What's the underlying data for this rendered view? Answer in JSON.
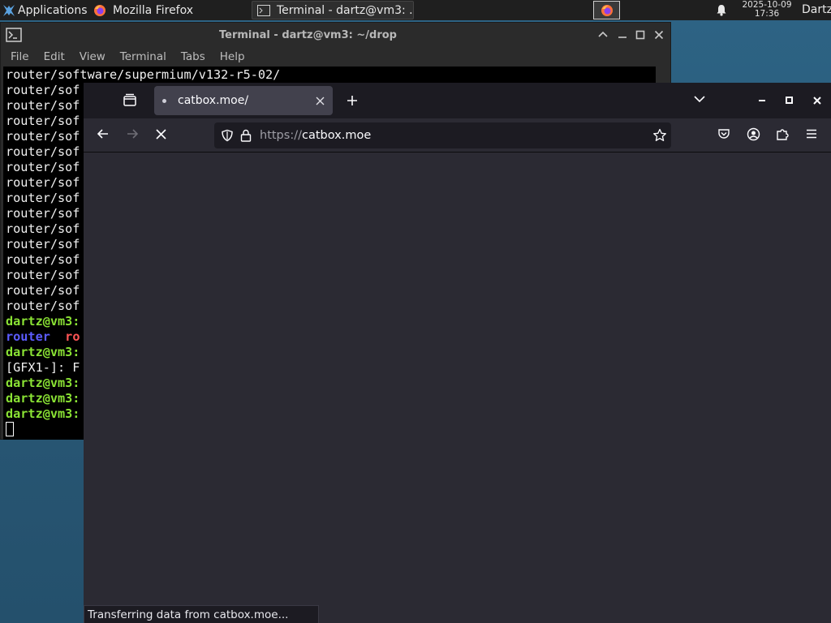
{
  "panel": {
    "applications_label": "Applications",
    "tasks": [
      {
        "label": "Mozilla Firefox"
      },
      {
        "label": "Terminal - dartz@vm3: ..."
      }
    ],
    "clock_date": "2025-10-09",
    "clock_time": "17:36",
    "user": "Dartz"
  },
  "terminal": {
    "title": "Terminal - dartz@vm3: ~/drop",
    "menu": [
      "File",
      "Edit",
      "View",
      "Terminal",
      "Tabs",
      "Help"
    ],
    "first_line": "router/software/supermium/v132-r5-02/",
    "repeated_line": "router/sof",
    "repeated_count": 15,
    "prompt": "dartz@vm3:",
    "ls_blue": "router",
    "ls_red": "ro",
    "gfx_line": "[GFX1-]: F"
  },
  "firefox": {
    "tab_title": "catbox.moe/",
    "url_protocol": "https://",
    "url_host": "catbox.moe",
    "status_text": "Transferring data from catbox.moe..."
  },
  "colors": {
    "panel_bg": "#1f1f1f",
    "terminal_prompt": "#8ae234",
    "firefox_bg": "#2b2a33",
    "firefox_tabbar": "#1c1b22"
  }
}
